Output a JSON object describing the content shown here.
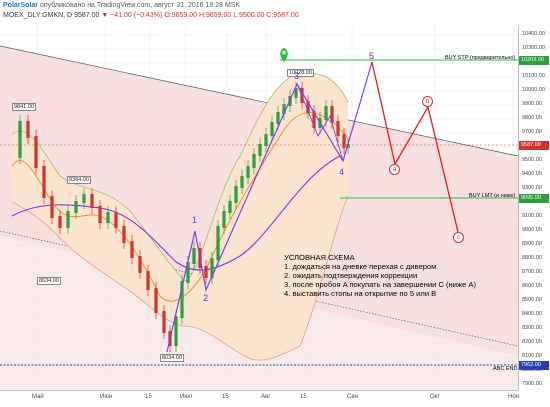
{
  "header": {
    "brand": "PolarSolar",
    "published": "опубликовано на TradingView.com, август 31, 2016 18:28 MSK",
    "symbol": "MOEX_DLY:GMKN, D",
    "price": "9587.00",
    "change": "▼",
    "change_value": "−41.00 (−0.43%)",
    "ohlc": "O:9659.00 H:9659.00 L:9500.00 C:9587.00"
  },
  "y_axis": {
    "ticks": [
      "10400.00",
      "10300.00",
      "10200.00",
      "10100.00",
      "10000.00",
      "9900.00",
      "9800.00",
      "9700.00",
      "9600.00",
      "9500.00",
      "9400.00",
      "9300.00",
      "9200.00",
      "9100.00",
      "9000.00",
      "8900.00",
      "8800.00",
      "8700.00",
      "8600.00",
      "8500.00",
      "8400.00",
      "8300.00",
      "8200.00",
      "8100.00",
      "8000.00",
      "7900.00"
    ],
    "price_tags": [
      {
        "label": "10203.00",
        "color": "#2e9e3e"
      },
      {
        "label": "9587.00",
        "color": "#d0342c"
      },
      {
        "label": "9095.00",
        "color": "#2e9e3e"
      },
      {
        "label": "7962.00",
        "color": "#2c3fb0"
      }
    ]
  },
  "x_axis": {
    "ticks": [
      "Май",
      "Июн",
      "15",
      "Июл",
      "15",
      "Авг",
      "15",
      "Сен",
      "Окт",
      "Ноя"
    ]
  },
  "price_labels": [
    "9841.00",
    "9384.00",
    "8634.00",
    "10028.00",
    "8034.00"
  ],
  "wave_labels": [
    "1",
    "2",
    "3",
    "4",
    "5"
  ],
  "correction_labels": [
    "a",
    "b",
    "c"
  ],
  "lines": {
    "buy_stop": "BUY STP (предварительно)",
    "buy_limit": "BUY LMT (и ниже)",
    "abc_end": "ABC END"
  },
  "note": {
    "title": "УСЛОВНАЯ СХЕМА",
    "items": [
      "1. дождаться на дневке перехая с дивером",
      "2. ожидать подтверждения коррекции",
      "3. после пробоя A покупать на завершении C (ниже A)",
      "4. выставить стопы на открытие по 5 или B"
    ]
  },
  "colors": {
    "up_candle": "#2e9e3e",
    "down_candle": "#d0342c",
    "wave": "#7b3fe4",
    "correction": "#e11d1d",
    "bb_band": "#f7c9a4",
    "channel": "#f6d6d6"
  }
}
